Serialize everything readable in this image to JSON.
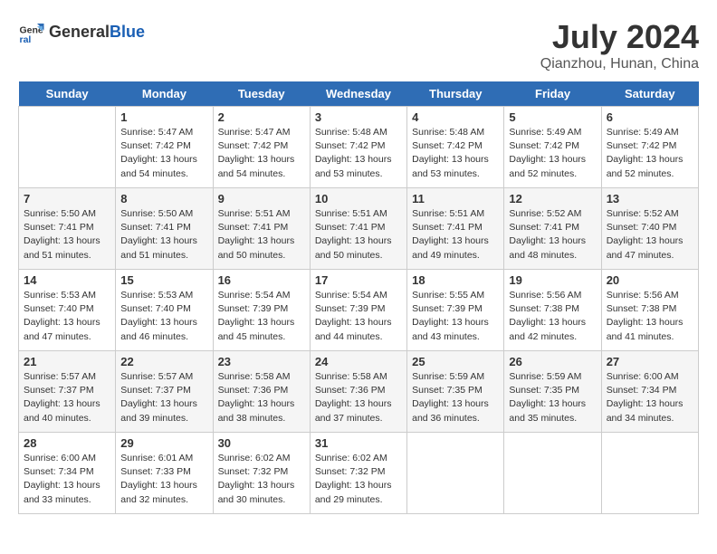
{
  "header": {
    "logo_general": "General",
    "logo_blue": "Blue",
    "title": "July 2024",
    "subtitle": "Qianzhou, Hunan, China"
  },
  "days_of_week": [
    "Sunday",
    "Monday",
    "Tuesday",
    "Wednesday",
    "Thursday",
    "Friday",
    "Saturday"
  ],
  "weeks": [
    [
      {
        "date": "",
        "info": ""
      },
      {
        "date": "1",
        "info": "Sunrise: 5:47 AM\nSunset: 7:42 PM\nDaylight: 13 hours\nand 54 minutes."
      },
      {
        "date": "2",
        "info": "Sunrise: 5:47 AM\nSunset: 7:42 PM\nDaylight: 13 hours\nand 54 minutes."
      },
      {
        "date": "3",
        "info": "Sunrise: 5:48 AM\nSunset: 7:42 PM\nDaylight: 13 hours\nand 53 minutes."
      },
      {
        "date": "4",
        "info": "Sunrise: 5:48 AM\nSunset: 7:42 PM\nDaylight: 13 hours\nand 53 minutes."
      },
      {
        "date": "5",
        "info": "Sunrise: 5:49 AM\nSunset: 7:42 PM\nDaylight: 13 hours\nand 52 minutes."
      },
      {
        "date": "6",
        "info": "Sunrise: 5:49 AM\nSunset: 7:42 PM\nDaylight: 13 hours\nand 52 minutes."
      }
    ],
    [
      {
        "date": "7",
        "info": "Sunrise: 5:50 AM\nSunset: 7:41 PM\nDaylight: 13 hours\nand 51 minutes."
      },
      {
        "date": "8",
        "info": "Sunrise: 5:50 AM\nSunset: 7:41 PM\nDaylight: 13 hours\nand 51 minutes."
      },
      {
        "date": "9",
        "info": "Sunrise: 5:51 AM\nSunset: 7:41 PM\nDaylight: 13 hours\nand 50 minutes."
      },
      {
        "date": "10",
        "info": "Sunrise: 5:51 AM\nSunset: 7:41 PM\nDaylight: 13 hours\nand 50 minutes."
      },
      {
        "date": "11",
        "info": "Sunrise: 5:51 AM\nSunset: 7:41 PM\nDaylight: 13 hours\nand 49 minutes."
      },
      {
        "date": "12",
        "info": "Sunrise: 5:52 AM\nSunset: 7:41 PM\nDaylight: 13 hours\nand 48 minutes."
      },
      {
        "date": "13",
        "info": "Sunrise: 5:52 AM\nSunset: 7:40 PM\nDaylight: 13 hours\nand 47 minutes."
      }
    ],
    [
      {
        "date": "14",
        "info": "Sunrise: 5:53 AM\nSunset: 7:40 PM\nDaylight: 13 hours\nand 47 minutes."
      },
      {
        "date": "15",
        "info": "Sunrise: 5:53 AM\nSunset: 7:40 PM\nDaylight: 13 hours\nand 46 minutes."
      },
      {
        "date": "16",
        "info": "Sunrise: 5:54 AM\nSunset: 7:39 PM\nDaylight: 13 hours\nand 45 minutes."
      },
      {
        "date": "17",
        "info": "Sunrise: 5:54 AM\nSunset: 7:39 PM\nDaylight: 13 hours\nand 44 minutes."
      },
      {
        "date": "18",
        "info": "Sunrise: 5:55 AM\nSunset: 7:39 PM\nDaylight: 13 hours\nand 43 minutes."
      },
      {
        "date": "19",
        "info": "Sunrise: 5:56 AM\nSunset: 7:38 PM\nDaylight: 13 hours\nand 42 minutes."
      },
      {
        "date": "20",
        "info": "Sunrise: 5:56 AM\nSunset: 7:38 PM\nDaylight: 13 hours\nand 41 minutes."
      }
    ],
    [
      {
        "date": "21",
        "info": "Sunrise: 5:57 AM\nSunset: 7:37 PM\nDaylight: 13 hours\nand 40 minutes."
      },
      {
        "date": "22",
        "info": "Sunrise: 5:57 AM\nSunset: 7:37 PM\nDaylight: 13 hours\nand 39 minutes."
      },
      {
        "date": "23",
        "info": "Sunrise: 5:58 AM\nSunset: 7:36 PM\nDaylight: 13 hours\nand 38 minutes."
      },
      {
        "date": "24",
        "info": "Sunrise: 5:58 AM\nSunset: 7:36 PM\nDaylight: 13 hours\nand 37 minutes."
      },
      {
        "date": "25",
        "info": "Sunrise: 5:59 AM\nSunset: 7:35 PM\nDaylight: 13 hours\nand 36 minutes."
      },
      {
        "date": "26",
        "info": "Sunrise: 5:59 AM\nSunset: 7:35 PM\nDaylight: 13 hours\nand 35 minutes."
      },
      {
        "date": "27",
        "info": "Sunrise: 6:00 AM\nSunset: 7:34 PM\nDaylight: 13 hours\nand 34 minutes."
      }
    ],
    [
      {
        "date": "28",
        "info": "Sunrise: 6:00 AM\nSunset: 7:34 PM\nDaylight: 13 hours\nand 33 minutes."
      },
      {
        "date": "29",
        "info": "Sunrise: 6:01 AM\nSunset: 7:33 PM\nDaylight: 13 hours\nand 32 minutes."
      },
      {
        "date": "30",
        "info": "Sunrise: 6:02 AM\nSunset: 7:32 PM\nDaylight: 13 hours\nand 30 minutes."
      },
      {
        "date": "31",
        "info": "Sunrise: 6:02 AM\nSunset: 7:32 PM\nDaylight: 13 hours\nand 29 minutes."
      },
      {
        "date": "",
        "info": ""
      },
      {
        "date": "",
        "info": ""
      },
      {
        "date": "",
        "info": ""
      }
    ]
  ]
}
